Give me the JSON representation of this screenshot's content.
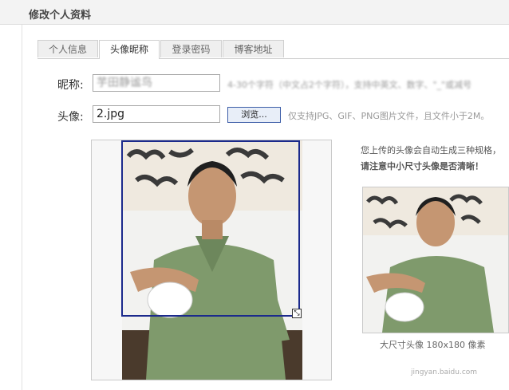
{
  "header": {
    "title": "修改个人资料"
  },
  "tabs": [
    {
      "label": "个人信息"
    },
    {
      "label": "头像昵称"
    },
    {
      "label": "登录密码"
    },
    {
      "label": "博客地址"
    }
  ],
  "form": {
    "nickname_label": "昵称:",
    "nickname_value": "芋田静谧鸟",
    "nickname_hint": "4-30个字符（中文占2个字符），支持中英文、数字、\"_\"或减号",
    "avatar_label": "头像:",
    "avatar_value": "2.jpg",
    "browse_label": "浏览...",
    "avatar_hint": "仅支持JPG、GIF、PNG图片文件，且文件小于2M。"
  },
  "side": {
    "note_line1": "您上传的头像会自动生成三种规格，",
    "note_line2": "请注意中小尺寸头像是否清晰！",
    "preview_caption": "大尺寸头像 180x180 像素"
  },
  "watermark": "jingyan.baidu.com"
}
